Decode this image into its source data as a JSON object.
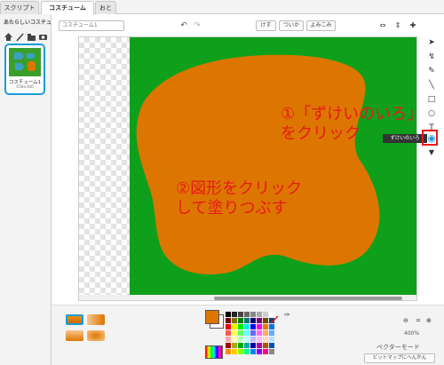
{
  "tabs": [
    {
      "label": "スクリプト"
    },
    {
      "label": "コスチューム"
    },
    {
      "label": "おと"
    }
  ],
  "left": {
    "new_costume_label": "あたらしいコスチューム:",
    "costume": {
      "name": "コスチューム1",
      "size": "458x360"
    }
  },
  "toolbar": {
    "costume_name": "コスチューム1",
    "clear": "けす",
    "add": "ついか",
    "import": "よみこみ"
  },
  "tooltip": "ずけいのいろ",
  "annotations": {
    "step1_line1": "①「ずけいのいろ」",
    "step1_line2": "をクリック",
    "step2_line1": "②図形をクリック",
    "step2_line2": "して塗りつぶす"
  },
  "bottom": {
    "zoom": "400%",
    "mode": "ベクターモード",
    "bitmap_button": "ビットマップにへんかん"
  },
  "colors": {
    "fill": "#dc7600",
    "canvas_bg": "#0ea01b",
    "annotation": "#e81a1a",
    "selected": "#1e9bd6"
  }
}
